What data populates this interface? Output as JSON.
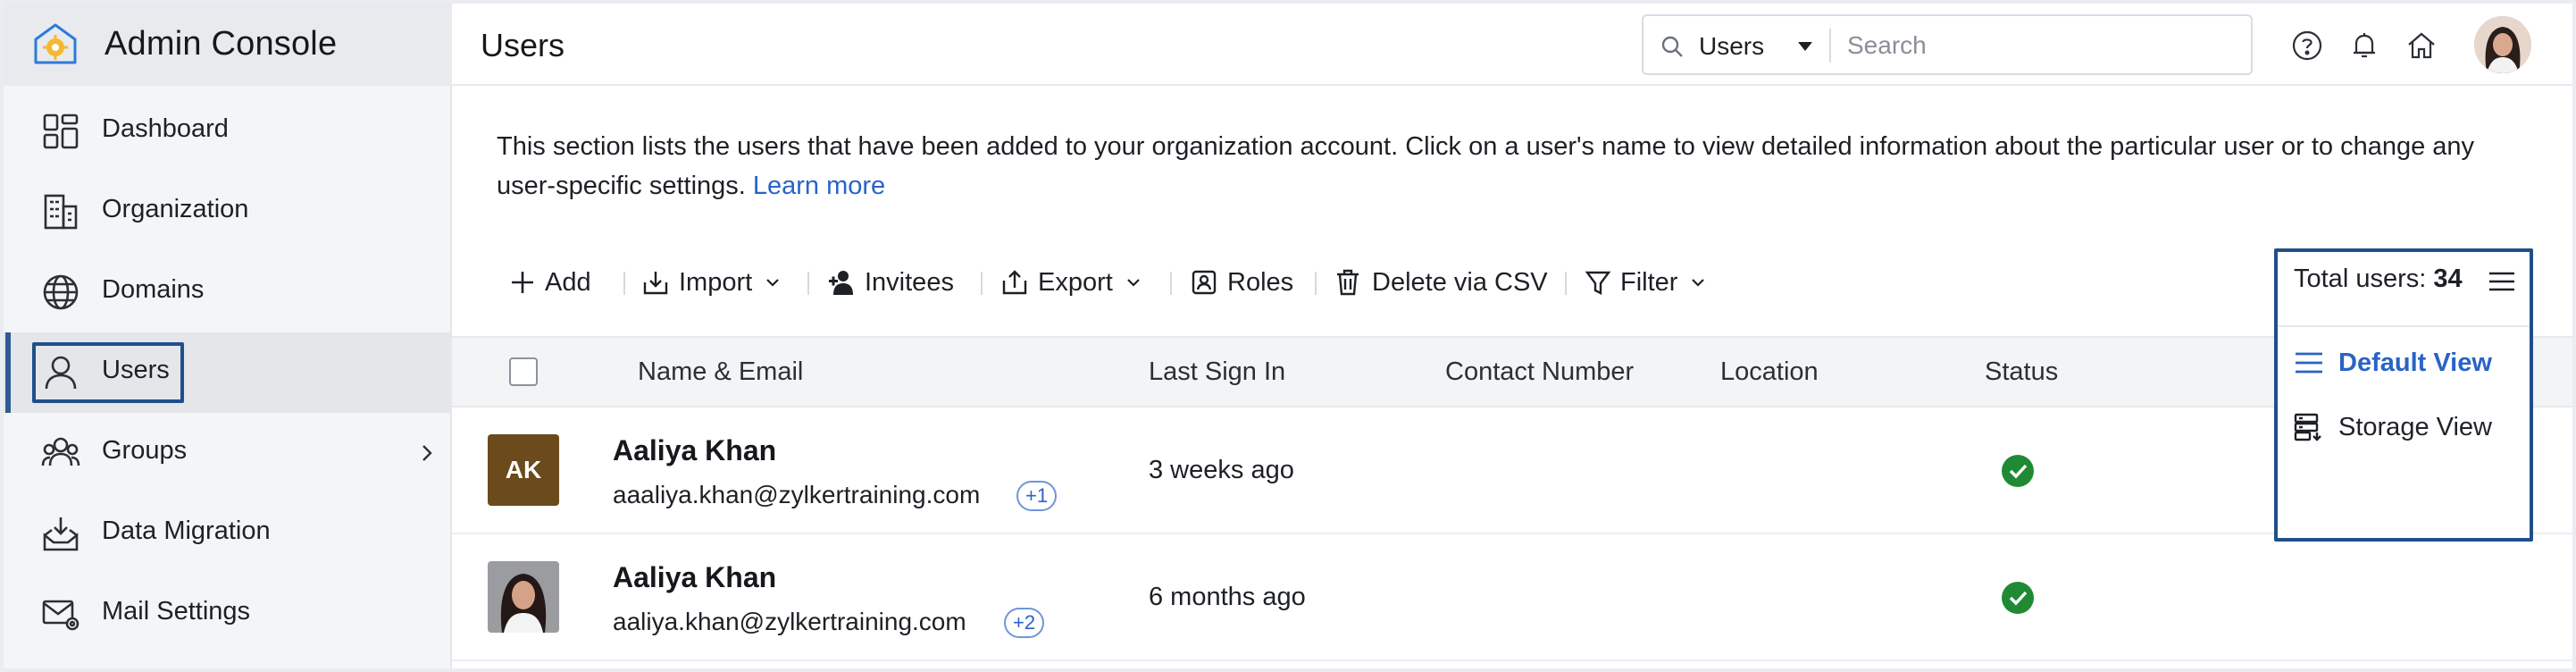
{
  "app": {
    "title": "Admin Console"
  },
  "sidebar": {
    "items": [
      {
        "label": "Dashboard",
        "icon": "dashboard-icon"
      },
      {
        "label": "Organization",
        "icon": "organization-icon"
      },
      {
        "label": "Domains",
        "icon": "globe-icon"
      },
      {
        "label": "Users",
        "icon": "user-icon",
        "active": true
      },
      {
        "label": "Groups",
        "icon": "groups-icon",
        "has_submenu": true
      },
      {
        "label": "Data Migration",
        "icon": "data-migration-icon"
      },
      {
        "label": "Mail Settings",
        "icon": "mail-settings-icon"
      }
    ]
  },
  "header": {
    "page_title": "Users",
    "search_scope": "Users",
    "search_placeholder": "Search",
    "icons": [
      "help-icon",
      "bell-icon",
      "home-icon"
    ]
  },
  "intro": {
    "text": "This section lists the users that have been added to your organization account. Click on a user's name to view detailed information about the particular user or to change any user-specific settings. ",
    "learn_more": "Learn more"
  },
  "toolbar": {
    "add": "Add",
    "import": "Import",
    "invitees": "Invitees",
    "export": "Export",
    "roles": "Roles",
    "delete_csv": "Delete via CSV",
    "filter": "Filter"
  },
  "total": {
    "label": "Total users:",
    "count": "34",
    "views": [
      {
        "label": "Default View",
        "selected": true
      },
      {
        "label": "Storage View",
        "selected": false
      }
    ]
  },
  "table": {
    "columns": [
      "Name & Email",
      "Last Sign In",
      "Contact Number",
      "Location",
      "Status"
    ],
    "rows": [
      {
        "initials": "AK",
        "name": "Aaliya Khan",
        "email": "aaaliya.khan@zylkertraining.com",
        "extra": "+1",
        "last_sign_in": "3 weeks ago",
        "status": "active"
      },
      {
        "initials": "",
        "name": "Aaliya Khan",
        "email": "aaliya.khan@zylkertraining.com",
        "extra": "+2",
        "last_sign_in": "6 months ago",
        "status": "active"
      }
    ]
  },
  "colors": {
    "accent": "#2a63c7",
    "highlight_border": "#1f4f8a",
    "success": "#1f8a33",
    "avatar_bg": "#6b4a1c"
  }
}
